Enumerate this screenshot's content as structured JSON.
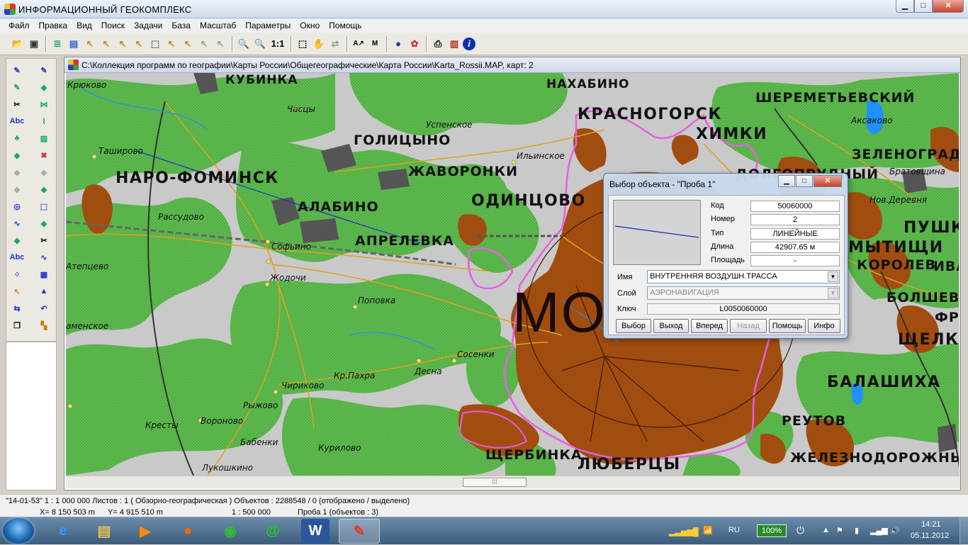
{
  "app": {
    "title": "ИНФОРМАЦИОННЫЙ ГЕОКОМПЛЕКС"
  },
  "menu": [
    "Файл",
    "Правка",
    "Вид",
    "Поиск",
    "Задачи",
    "База",
    "Масштаб",
    "Параметры",
    "Окно",
    "Помощь"
  ],
  "toolbar": {
    "scale_one": "1:1"
  },
  "lefttools": {
    "abc1": "Abc",
    "abc2": "Abc"
  },
  "map_window": {
    "title": "C:\\Коллекция программ по географии\\Карты России\\Общегеографические\\Карта России\\Karta_Rossii.MAP, карт: 2"
  },
  "map_labels": {
    "kubinka": "КУБИНКА",
    "nakhabino": "НАХАБИНО",
    "krasnogorsk": "КРАСНОГОРСК",
    "sheremetyevsky": "ШЕРЕМЕТЬЕВСКИЙ",
    "khimki": "ХИМКИ",
    "zelenograd": "ЗЕЛЕНОГРАДСК",
    "golitsyno": "ГОЛИЦЫНО",
    "zhavoronki": "ЖАВОРОНКИ",
    "naro_fominsk": "НАРО-ФОМИНСК",
    "alabino": "АЛАБИНО",
    "aprelevka": "АПРЕЛЕВКА",
    "odintsovo": "ОДИНЦОВО",
    "dolgoprudny": "ДОЛГОПРУДНЫЙ",
    "pushk": "ПУШК",
    "mytishchi": "МЫТИЩИ",
    "korolev": "КОРОЛЕВ",
    "iva": "ИВА",
    "bolshevo": "БОЛШЕВО",
    "fr": "ФР",
    "shchelk": "ЩЕЛКО",
    "balashikha": "БАЛАШИХА",
    "reutov": "РЕУТОВ",
    "zheleznodorozhny": "ЖЕЛЕЗНОДОРОЖНЫЙ",
    "shcherbinka": "ЩЕРБИНКА",
    "lyubertsy": "ЛЮБЕРЦЫ",
    "moscow": "МО",
    "kryukovo": "Крюково",
    "chastsy": "Часцы",
    "uspenskoe": "Успенское",
    "ilinskoe": "Ильинское",
    "aksakovo": "Аксаково",
    "bratovshchina": "Братовщина",
    "nov_derevnya": "Нов.Деревня",
    "tashirovo": "Таширово",
    "rassudovo": "Рассудово",
    "sofyino": "Софьино",
    "atepcevo": "Атепцево",
    "zhodochi": "Жодочи",
    "popovka": "Поповка",
    "amenskoe": "аменское",
    "sosenki": "Сосенки",
    "desna": "Десна",
    "kr_pakhra": "Кр.Пахра",
    "chirikovo": "Чириково",
    "ryzhovo": "Рыжово",
    "kresty": "Кресты",
    "voronovo": "Вороново",
    "babenki": "Бабенки",
    "kurilovo": "Курилово",
    "lukoshkino": "Лукошкино"
  },
  "dialog": {
    "title": "Выбор объекта - \"Проба 1\"",
    "fields": {
      "code_label": "Код",
      "code": "50060000",
      "number_label": "Номер",
      "number": "2",
      "type_label": "Тип",
      "type": "ЛИНЕЙНЫЕ",
      "length_label": "Длина",
      "length": "42907.65  м",
      "area_label": "Площадь",
      "area": "-"
    },
    "name_label": "Имя",
    "name_value": "ВНУТРЕННЯЯ ВОЗДУШН.ТРАССА",
    "layer_label": "Слой",
    "layer_value": "АЭРОНАВИГАЦИЯ",
    "key_label": "Ключ",
    "key_value": "L0050060000",
    "buttons": [
      "Выбор",
      "Выход",
      "Вперед",
      "Назад",
      "Помощь",
      "Инфо"
    ]
  },
  "status": {
    "line1": "\"14-01-53\"  1 : 1 000 000   Листов : 1   ( Обзорно-географическая )  Объектов : 2288548 / 0 (отображено / выделено)",
    "x": "X=   8 150 503 m",
    "y": "Y=   4 915 510 m",
    "scale": "1 : 500 000",
    "layer": "Проба 1   (объектов : 3)"
  },
  "taskbar": {
    "lang": "RU",
    "battery": "100%",
    "time": "14:21",
    "date": "05.11.2012"
  },
  "colors": {
    "forest": "#5db84d",
    "city": "#a14d0f",
    "boundary": "#e85de4",
    "water": "#1e90ff",
    "road": "#e0a020"
  }
}
